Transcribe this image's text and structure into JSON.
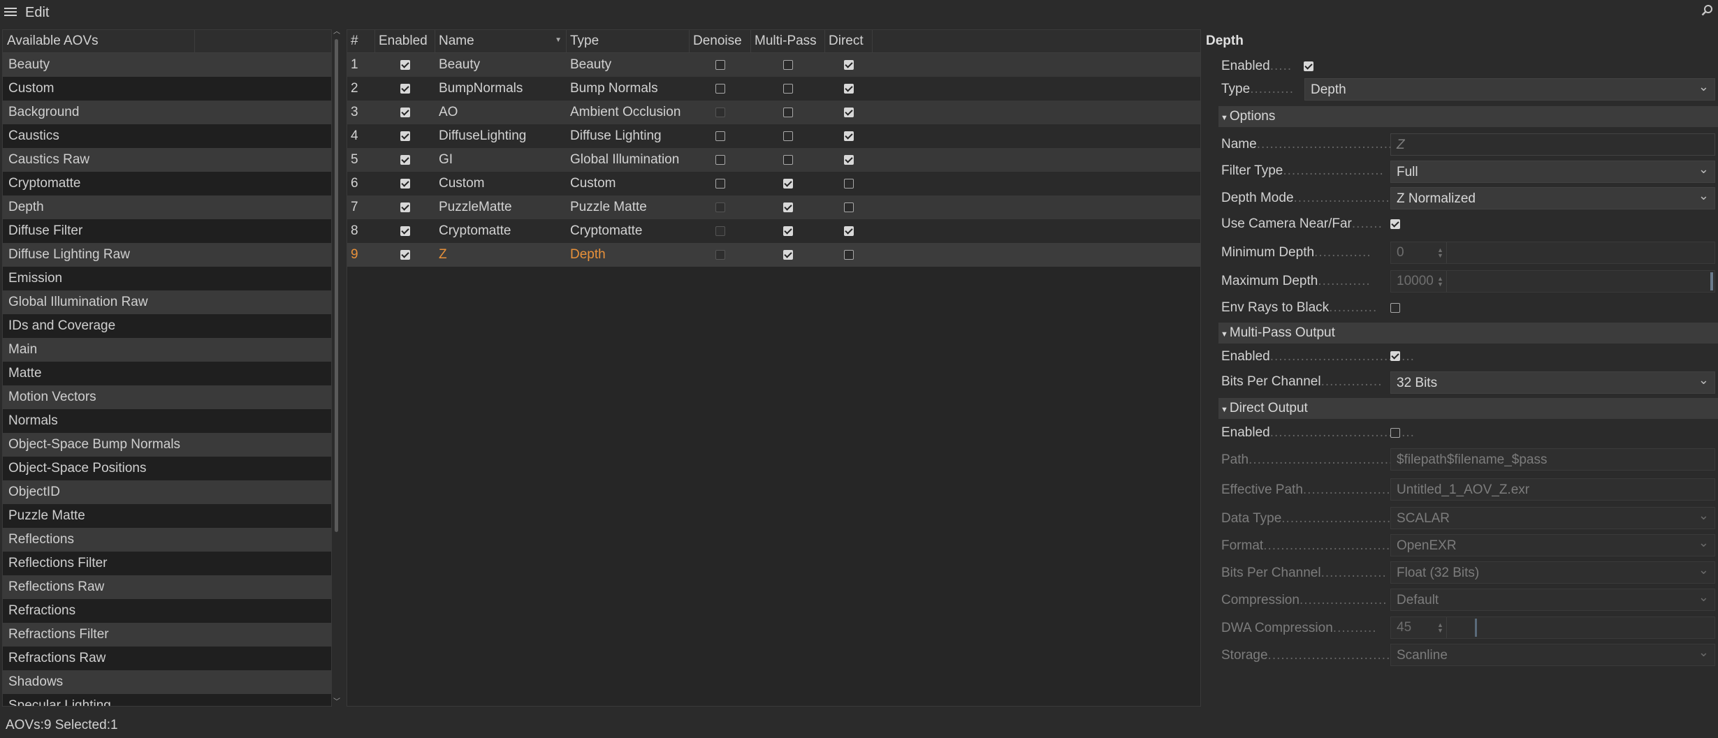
{
  "topbar": {
    "menu_label": "Edit"
  },
  "left_panel": {
    "header": "Available AOVs",
    "items": [
      "Beauty",
      "Custom",
      "Background",
      "Caustics",
      "Caustics Raw",
      "Cryptomatte",
      "Depth",
      "Diffuse Filter",
      "Diffuse Lighting Raw",
      "Emission",
      "Global Illumination Raw",
      "IDs and Coverage",
      "Main",
      "Matte",
      "Motion Vectors",
      "Normals",
      "Object-Space Bump Normals",
      "Object-Space Positions",
      "ObjectID",
      "Puzzle Matte",
      "Reflections",
      "Reflections Filter",
      "Reflections Raw",
      "Refractions",
      "Refractions Filter",
      "Refractions Raw",
      "Shadows",
      "Specular Lighting"
    ]
  },
  "table": {
    "columns": [
      "#",
      "Enabled",
      "Name",
      "Type",
      "Denoise",
      "Multi-Pass",
      "Direct"
    ],
    "rows": [
      {
        "idx": "1",
        "enabled": true,
        "name": "Beauty",
        "type": "Beauty",
        "denoise": "off",
        "multipass": "off",
        "direct": "on"
      },
      {
        "idx": "2",
        "enabled": true,
        "name": "BumpNormals",
        "type": "Bump Normals",
        "denoise": "off",
        "multipass": "off",
        "direct": "on"
      },
      {
        "idx": "3",
        "enabled": true,
        "name": "AO",
        "type": "Ambient Occlusion",
        "denoise": "dis",
        "multipass": "off",
        "direct": "on"
      },
      {
        "idx": "4",
        "enabled": true,
        "name": "DiffuseLighting",
        "type": "Diffuse Lighting",
        "denoise": "off",
        "multipass": "off",
        "direct": "on"
      },
      {
        "idx": "5",
        "enabled": true,
        "name": "GI",
        "type": "Global Illumination",
        "denoise": "off",
        "multipass": "off",
        "direct": "on"
      },
      {
        "idx": "6",
        "enabled": true,
        "name": "Custom",
        "type": "Custom",
        "denoise": "off",
        "multipass": "on",
        "direct": "off"
      },
      {
        "idx": "7",
        "enabled": true,
        "name": "PuzzleMatte",
        "type": "Puzzle Matte",
        "denoise": "dis",
        "multipass": "on",
        "direct": "off"
      },
      {
        "idx": "8",
        "enabled": true,
        "name": "Cryptomatte",
        "type": "Cryptomatte",
        "denoise": "dis",
        "multipass": "on",
        "direct": "on"
      },
      {
        "idx": "9",
        "enabled": true,
        "name": "Z",
        "type": "Depth",
        "denoise": "dis",
        "multipass": "on",
        "direct": "off",
        "selected": true
      }
    ]
  },
  "props": {
    "title": "Depth",
    "enabled_label": "Enabled",
    "enabled_dots": ".....",
    "type_label": "Type",
    "type_dots": "..........",
    "type_value": "Depth",
    "options_section": "Options",
    "name_label": "Name",
    "name_dots": "..................................",
    "name_value": "Z",
    "filter_type_label": "Filter Type",
    "filter_type_dots": ".......................",
    "filter_type_value": "Full",
    "depth_mode_label": "Depth Mode",
    "depth_mode_dots": "......................",
    "depth_mode_value": "Z Normalized",
    "use_camera_label": "Use Camera Near/Far",
    "use_camera_dots": ".......",
    "min_depth_label": "Minimum Depth",
    "min_depth_dots": ".............",
    "min_depth_value": "0",
    "max_depth_label": "Maximum Depth",
    "max_depth_dots": "............",
    "max_depth_value": "10000",
    "env_rays_label": "Env Rays to Black",
    "env_rays_dots": "...........",
    "multipass_section": "Multi-Pass Output",
    "mp_enabled_label": "Enabled",
    "mp_enabled_dots": ".................................",
    "mp_bits_label": "Bits Per Channel",
    "mp_bits_dots": "..............",
    "mp_bits_value": "32 Bits",
    "direct_section": "Direct Output",
    "do_enabled_label": "Enabled",
    "do_enabled_dots": ".................................",
    "path_label": "Path",
    "path_dots": ".........................................",
    "path_value": "$filepath$filename_$pass",
    "eff_path_label": "Effective Path",
    "eff_path_dots": ".....................",
    "eff_path_value": "Untitled_1_AOV_Z.exr",
    "data_type_label": "Data Type",
    "data_type_dots": "..........................",
    "data_type_value": "SCALAR",
    "format_label": "Format",
    "format_dots": "...............................",
    "format_value": "OpenEXR",
    "do_bits_label": "Bits Per Channel",
    "do_bits_dots": "...............",
    "do_bits_value": "Float (32 Bits)",
    "compression_label": "Compression",
    "compression_dots": "....................",
    "compression_value": "Default",
    "dwa_label": "DWA Compression",
    "dwa_dots": "..........",
    "dwa_value": "45",
    "storage_label": "Storage",
    "storage_dots": "..............................",
    "storage_value": "Scanline"
  },
  "status": {
    "text": "AOVs:9 Selected:1"
  }
}
